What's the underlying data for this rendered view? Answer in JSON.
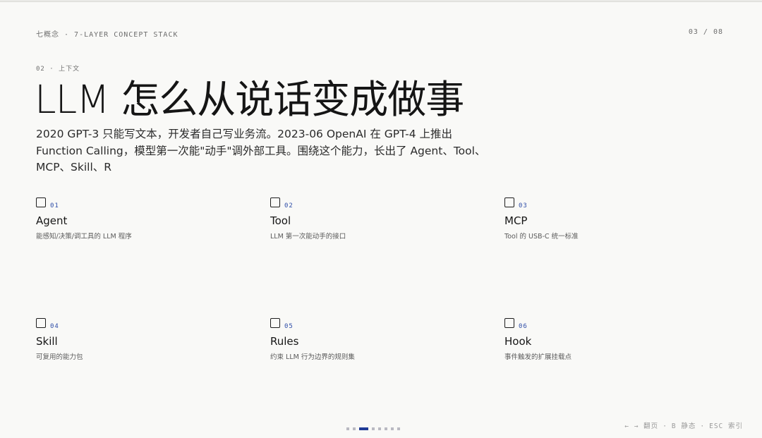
{
  "header": {
    "deck_label": "七概念 · 7-LAYER CONCEPT STACK",
    "page_counter": "03 / 08"
  },
  "slide": {
    "section_label": "02 · 上下文",
    "title": "LLM 怎么从说话变成做事",
    "lead": "2020 GPT-3 只能写文本，开发者自己写业务流。2023-06 OpenAI 在 GPT-4 上推出 Function Calling，模型第一次能\"动手\"调外部工具。围绕这个能力，长出了 Agent、Tool、MCP、Skill、R"
  },
  "concepts": [
    {
      "num": "01",
      "name": "Agent",
      "desc": "能感知/决策/调工具的 LLM 程序"
    },
    {
      "num": "02",
      "name": "Tool",
      "desc": "LLM 第一次能动手的接口"
    },
    {
      "num": "03",
      "name": "MCP",
      "desc": "Tool 的 USB-C 统一标准"
    },
    {
      "num": "04",
      "name": "Skill",
      "desc": "可复用的能力包"
    },
    {
      "num": "05",
      "name": "Rules",
      "desc": "约束 LLM 行为边界的规则集"
    },
    {
      "num": "06",
      "name": "Hook",
      "desc": "事件触发的扩展挂载点"
    }
  ],
  "pagination": {
    "total": 8,
    "current": 3
  },
  "footer": {
    "hint_nav": "← → 翻页",
    "hint_static": "B 静态",
    "hint_index": "ESC 索引",
    "separator": "·"
  },
  "colors": {
    "accent": "#1f3a96",
    "number": "#2f4ea8",
    "background": "#f9f9f7"
  }
}
